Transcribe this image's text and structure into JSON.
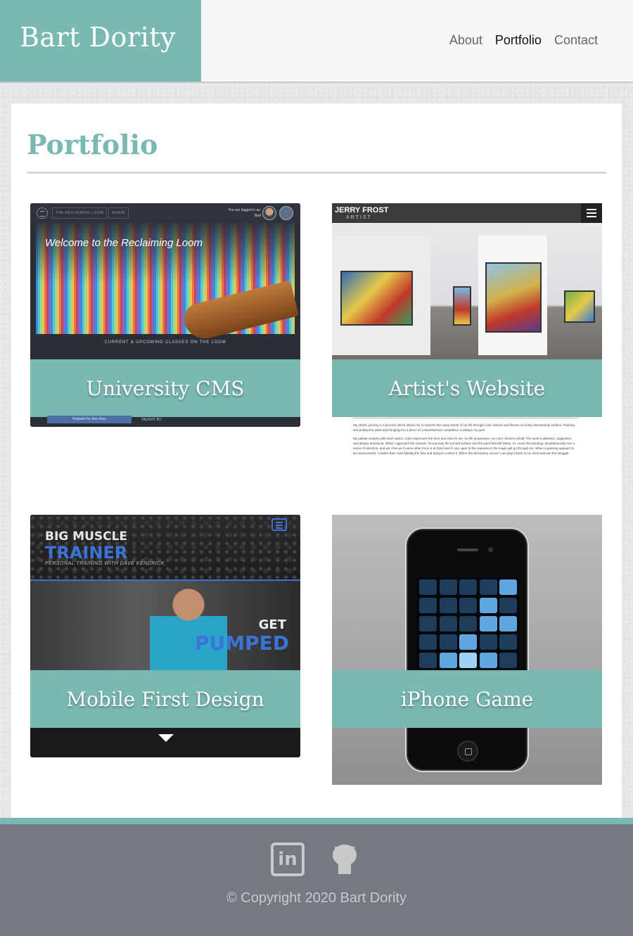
{
  "site": {
    "brand": "Bart Dority",
    "accent": "#7ab8b2"
  },
  "nav": {
    "items": [
      {
        "label": "About",
        "active": false
      },
      {
        "label": "Portfolio",
        "active": true
      },
      {
        "label": "Contact",
        "active": false
      }
    ]
  },
  "page": {
    "title": "Portfolio"
  },
  "projects": [
    {
      "label": "University CMS",
      "screenshot": {
        "chips": [
          "THE RECLAIMING LOOM",
          "ADMIN"
        ],
        "logged_in": "You are logged in as:",
        "user": "Bart",
        "welcome": "Welcome to the Reclaiming Loom",
        "classes": "CURRENT & UPCOMING CLASSES ON THE LOOM",
        "register": "Register for this class",
        "taught_by": "TAUGHT BY:"
      }
    },
    {
      "label": "Artist's Website",
      "screenshot": {
        "name": "JERRY FROST",
        "role": "ARTIST",
        "paragraphs": [
          "My artistic journey is a process which allows me to express the many levels of my life through color, texture and illusion on a two dimensional surface. Pushing and pulling the paint and bringing it to a place of comprehensive completion is always my goal.",
          "My palette evolves with each series. Color expresses the here and now for me. As life progresses, my color choices unfold. The work is abstract, suggestive, and always emotional. When I approach the canvas I incorporate the primed surface and the paint that will follow. As I work the painting I simultaneously see a sense of direction, and yet I feel as if some other force is at hand and if I am open to the experience the magic will go through me. When a painting appears to be unsuccessful, I realize that I was fighting the flow and trying to control it. When this dichotomy occurs I can play it back in my mind and see the struggle."
        ]
      }
    },
    {
      "label": "Mobile First Design",
      "screenshot": {
        "big": "BIG MUSCLE",
        "trainer": "TRAINER",
        "subtitle": "PERSONAL TRAINING WITH DAVE KENDRICK",
        "get": "GET",
        "pumped": "PUMPED"
      }
    },
    {
      "label": "iPhone Game"
    }
  ],
  "footer": {
    "linkedin_icon": "linkedin-icon",
    "linkedin_glyph": "in",
    "github_icon": "github-icon",
    "copyright": "© Copyright 2020 Bart Dority"
  }
}
